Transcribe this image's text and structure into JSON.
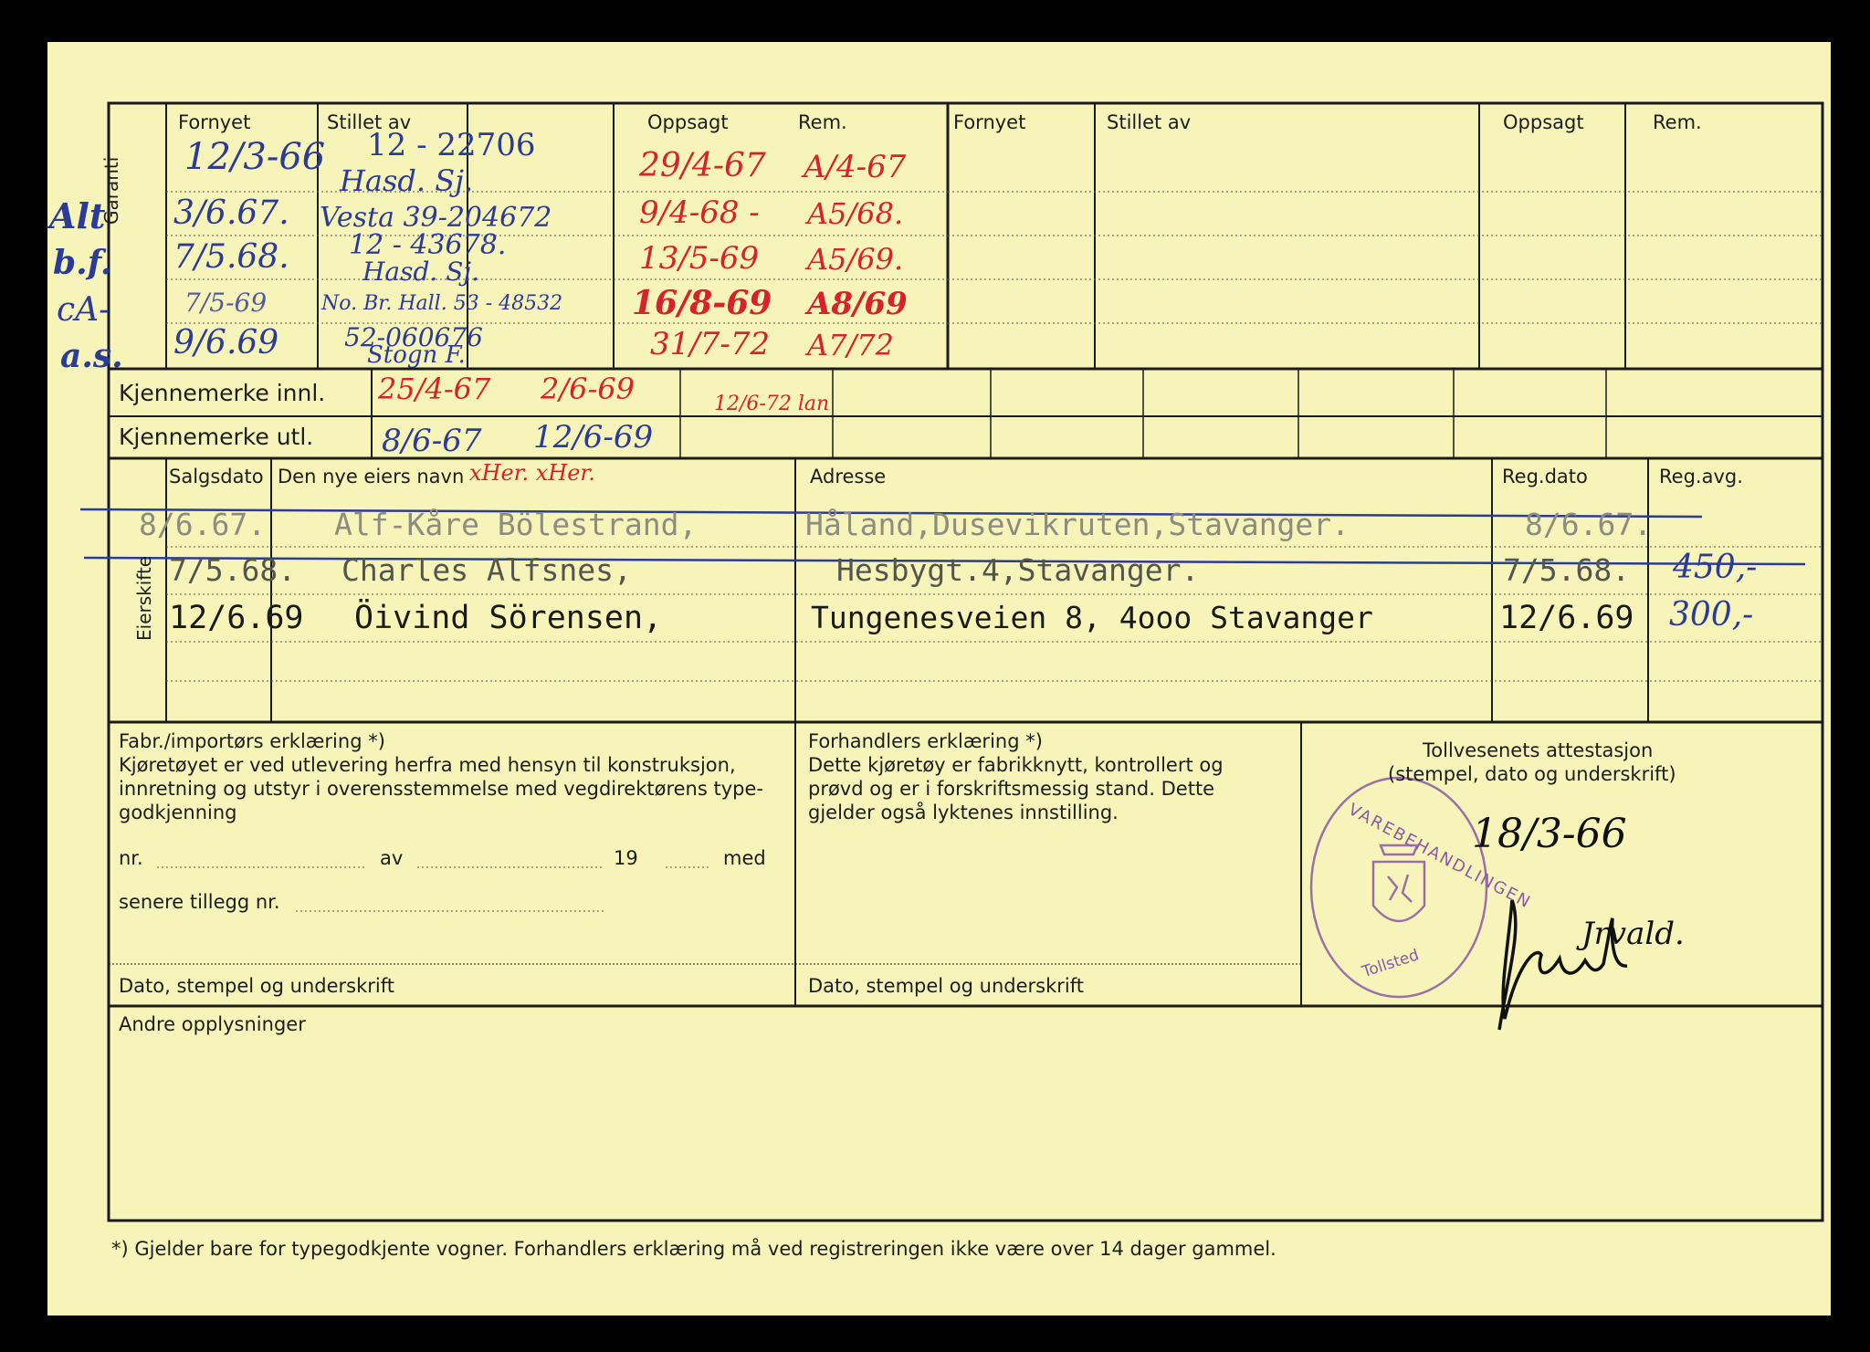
{
  "top_section": {
    "headers_left": {
      "fornyet": "Fornyet",
      "stillet_av": "Stillet av",
      "oppsagt": "Oppsagt",
      "rem": "Rem."
    },
    "headers_right": {
      "fornyet": "Fornyet",
      "stillet_av": "Stillet av",
      "oppsagt": "Oppsagt",
      "rem": "Rem."
    },
    "side_label": "Garanti",
    "rows": [
      {
        "fornyet": "12/3-66",
        "stillet_av": "12 - 22706",
        "oppsagt": "29/4-67",
        "rem": "A/4-67"
      },
      {
        "fornyet": "3/6.67.",
        "stillet_av": "Hasd. Sj.",
        "oppsagt": "9/4-68 -",
        "rem": "A5/68."
      },
      {
        "fornyet": "7/5.68.",
        "stillet_av": "Vesta 39-204672",
        "oppsagt": "13/5-69",
        "rem": "A5/69."
      },
      {
        "fornyet": "7/5-69",
        "stillet_av": "12 - 43678.",
        "oppsagt": "16/8-69",
        "rem": "A8/69"
      },
      {
        "fornyet": "9/6.69",
        "stillet_av": "Hasd. Sj.",
        "oppsagt": "31/7-72",
        "rem": "A7/72"
      }
    ],
    "row_extra": [
      "No. Br. Hall. 53 - 48532",
      "52-060676",
      "Stogn F."
    ],
    "margin_notes": [
      "Alt",
      "b.f.",
      "cA-",
      "a.s."
    ]
  },
  "kjennemerke": {
    "innl_label": "Kjennemerke innl.",
    "utl_label": "Kjennemerke utl.",
    "innl_values": [
      "25/4-67",
      "2/6-69",
      "12/6-72 lan"
    ],
    "utl_values": [
      "8/6-67",
      "12/6-69"
    ]
  },
  "eierskifte": {
    "side_label": "Eierskifte",
    "headers": {
      "salgsdato": "Salgsdato",
      "navn": "Den nye eiers navn",
      "adresse": "Adresse",
      "regdato": "Reg.dato",
      "regavg": "Reg.avg."
    },
    "header_note": "xHer. xHer.",
    "rows": [
      {
        "salgsdato": "8/6.67.",
        "navn": "Alf-Kåre Bölestrand,",
        "adresse": "Håland,Dusevikruten,Stavanger.",
        "regdato": "8/6.67.",
        "regavg": ""
      },
      {
        "salgsdato": "7/5.68.",
        "navn": "Charles Alfsnes,",
        "adresse": "Hesbygt.4,Stavanger.",
        "regdato": "7/5.68.",
        "regavg": "450,-"
      },
      {
        "salgsdato": "12/6.69",
        "navn": "Öivind Sörensen,",
        "adresse": "Tungenesveien 8, 4ooo Stavanger",
        "regdato": "12/6.69",
        "regavg": "300,-"
      }
    ]
  },
  "fabrikant": {
    "title": "Fabr./importørs erklæring *)",
    "lines": [
      "Kjøretøyet er ved utlevering herfra med hensyn til konstruksjon,",
      "innretning og utstyr i overensstemmelse med vegdirektørens type-",
      "godkjenning"
    ],
    "nr_label": "nr.",
    "av_label": "av",
    "year_label": "19",
    "med_label": "med",
    "tillegg_label": "senere tillegg nr.",
    "signature_label": "Dato, stempel og underskrift"
  },
  "forhandler": {
    "title": "Forhandlers erklæring *)",
    "lines": [
      "Dette kjøretøy er fabrikknytt, kontrollert og",
      "prøvd og er i forskriftsmessig stand. Dette",
      "gjelder også lyktenes innstilling."
    ],
    "signature_label": "Dato, stempel og underskrift"
  },
  "toll": {
    "title": "Tollvesenets attestasjon",
    "subtitle": "(stempel, dato og underskrift)",
    "date": "18/3-66",
    "signature": "Jrvald.",
    "stamp_text": "VAREBEHANDLINGEN",
    "stamp_sub": "Tollsted"
  },
  "andre_label": "Andre opplysninger",
  "footnote": "*)   Gjelder bare for typegodkjente vogner.   Forhandlers erklæring må ved registreringen ikke være over 14 dager gammel.",
  "colors": {
    "paper": "#f7f4b9",
    "ink_blue": "#2a3b98",
    "ink_red": "#d8222b",
    "stamp_violet": "#8a5aa6"
  }
}
